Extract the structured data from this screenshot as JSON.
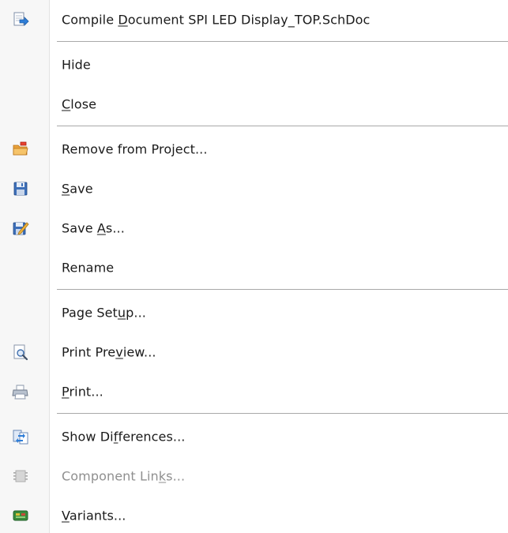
{
  "context_menu": {
    "items": [
      {
        "id": "compile",
        "icon": "compile-icon",
        "pre": "Compile ",
        "key": "D",
        "post": "ocument SPI LED Display_TOP.SchDoc",
        "enabled": true
      },
      {
        "id": "hide",
        "icon": null,
        "pre": "Hide",
        "key": "",
        "post": "",
        "enabled": true
      },
      {
        "id": "close",
        "icon": null,
        "pre": "",
        "key": "C",
        "post": "lose",
        "enabled": true
      },
      {
        "id": "remove",
        "icon": "remove-folder-icon",
        "pre": "Remove from Project...",
        "key": "",
        "post": "",
        "enabled": true
      },
      {
        "id": "save",
        "icon": "floppy-disk-icon",
        "pre": "",
        "key": "S",
        "post": "ave",
        "enabled": true
      },
      {
        "id": "save-as",
        "icon": "save-as-icon",
        "pre": "Save ",
        "key": "A",
        "post": "s...",
        "enabled": true
      },
      {
        "id": "rename",
        "icon": null,
        "pre": "Rename",
        "key": "",
        "post": "",
        "enabled": true
      },
      {
        "id": "page-setup",
        "icon": null,
        "pre": "Page Set",
        "key": "u",
        "post": "p...",
        "enabled": true
      },
      {
        "id": "print-preview",
        "icon": "print-preview-icon",
        "pre": "Print Pre",
        "key": "v",
        "post": "iew...",
        "enabled": true
      },
      {
        "id": "print",
        "icon": "printer-icon",
        "pre": "",
        "key": "P",
        "post": "rint...",
        "enabled": true
      },
      {
        "id": "show-differences",
        "icon": "differences-icon",
        "pre": "Show Di",
        "key": "f",
        "post": "ferences...",
        "enabled": true
      },
      {
        "id": "component-links",
        "icon": "component-links-icon",
        "pre": "Component Lin",
        "key": "k",
        "post": "s...",
        "enabled": false
      },
      {
        "id": "variants",
        "icon": "variants-icon",
        "pre": "",
        "key": "V",
        "post": "ariants...",
        "enabled": true
      }
    ]
  }
}
